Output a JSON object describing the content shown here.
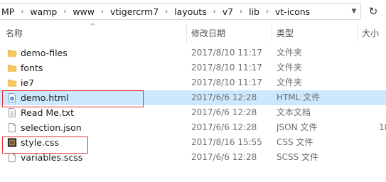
{
  "address": {
    "crumbs": [
      "MP",
      "wamp",
      "www",
      "vtigercrm7",
      "layouts",
      "v7",
      "lib",
      "vt-icons"
    ],
    "separator": "›"
  },
  "columns": {
    "name": "名称",
    "date": "修改日期",
    "type": "类型",
    "size": "大小"
  },
  "files": [
    {
      "name": "demo-files",
      "date": "2017/8/10 11:17",
      "type": "文件夹",
      "size": "",
      "icon": "folder-icon"
    },
    {
      "name": "fonts",
      "date": "2017/8/10 11:17",
      "type": "文件夹",
      "size": "",
      "icon": "folder-icon"
    },
    {
      "name": "ie7",
      "date": "2017/8/10 11:17",
      "type": "文件夹",
      "size": "",
      "icon": "folder-icon"
    },
    {
      "name": "demo.html",
      "date": "2017/6/6 12:28",
      "type": "HTML 文件",
      "size": "",
      "icon": "html-file-icon",
      "selected": true
    },
    {
      "name": "Read Me.txt",
      "date": "2017/6/6 12:28",
      "type": "文本文档",
      "size": "",
      "icon": "text-file-icon"
    },
    {
      "name": "selection.json",
      "date": "2017/6/6 12:28",
      "type": "JSON 文件",
      "size": "18",
      "icon": "file-icon"
    },
    {
      "name": "style.css",
      "date": "2017/8/16 15:55",
      "type": "CSS 文件",
      "size": "",
      "icon": "css-file-icon"
    },
    {
      "name": "variables.scss",
      "date": "2017/6/6 12:28",
      "type": "SCSS 文件",
      "size": "",
      "icon": "file-icon"
    }
  ],
  "colors": {
    "selection": "#cce8ff",
    "folder": "#e8b64a",
    "annotation": "#e03030"
  }
}
